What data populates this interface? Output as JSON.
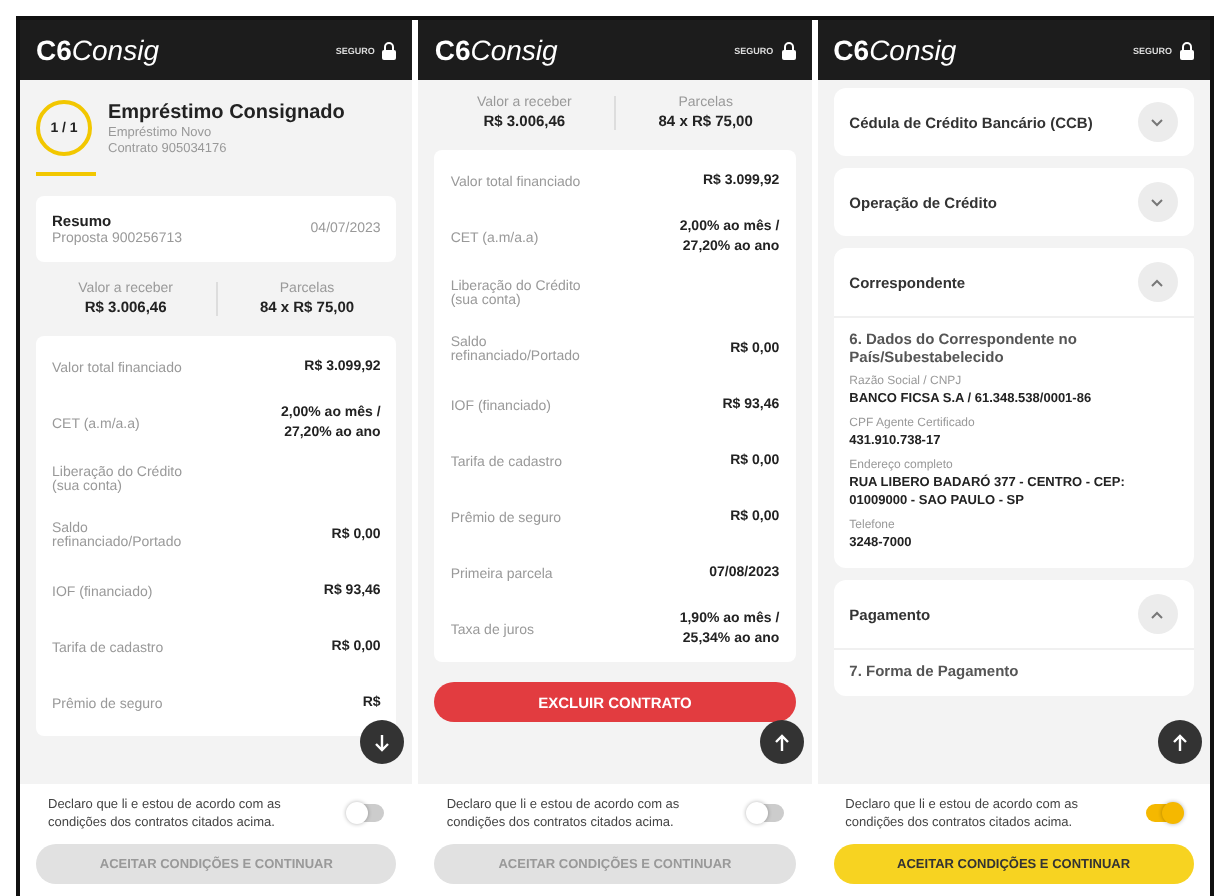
{
  "screens": [
    {
      "header": {
        "logo_mark": "C6",
        "logo_text": "Consig",
        "secure_label": "SEGURO"
      },
      "fab": {
        "kind": "scroll_down"
      },
      "blocks": [
        {
          "kind": "contract",
          "counter": "1 / 1",
          "title": "Empréstimo Consignado",
          "subtitle": "Empréstimo Novo",
          "contract": "Contrato 905034176"
        },
        {
          "kind": "summary",
          "title": "Resumo",
          "proposal": "Proposta 900256713",
          "date": "04/07/2023"
        },
        {
          "kind": "amounts",
          "items": [
            {
              "label": "Valor a receber",
              "value": "R$ 3.006,46"
            },
            {
              "label": "Parcelas",
              "value": "84 x  R$ 75,00"
            }
          ]
        },
        {
          "kind": "rows",
          "rows": [
            {
              "label": "Valor total financiado",
              "value": "R$ 3.099,92"
            },
            {
              "label": "CET (a.m/a.a)",
              "value": "2,00% ao mês /\n27,20% ao ano"
            },
            {
              "label": "Liberação do Crédito\n(sua conta)"
            },
            {
              "label": "Saldo\nrefinanciado/Portado",
              "value": "R$ 0,00"
            },
            {
              "label": "IOF (financiado)",
              "value": "R$ 93,46"
            },
            {
              "label": "Tarifa de cadastro",
              "value": "R$ 0,00"
            },
            {
              "label": "Prêmio de seguro",
              "value": "R$"
            }
          ]
        }
      ],
      "footer": {
        "consent": "Declaro que li e estou de acordo com as condições dos contratos citados acima.",
        "agreed": false,
        "button": "ACEITAR CONDIÇÕES E CONTINUAR",
        "enabled": false
      }
    },
    {
      "header": {
        "logo_mark": "C6",
        "logo_text": "Consig",
        "secure_label": "SEGURO"
      },
      "fab": {
        "kind": "scroll_up"
      },
      "blocks": [
        {
          "kind": "amounts",
          "items": [
            {
              "label": "Valor a receber",
              "value": "R$ 3.006,46"
            },
            {
              "label": "Parcelas",
              "value": "84 x  R$ 75,00"
            }
          ]
        },
        {
          "kind": "rows",
          "rows": [
            {
              "label": "Valor total financiado",
              "value": "R$ 3.099,92"
            },
            {
              "label": "CET (a.m/a.a)",
              "value": "2,00% ao mês /\n27,20% ao ano"
            },
            {
              "label": "Liberação do Crédito\n(sua conta)"
            },
            {
              "label": "Saldo\nrefinanciado/Portado",
              "value": "R$ 0,00"
            },
            {
              "label": "IOF (financiado)",
              "value": "R$ 93,46"
            },
            {
              "label": "Tarifa de cadastro",
              "value": "R$ 0,00"
            },
            {
              "label": "Prêmio de seguro",
              "value": "R$ 0,00"
            },
            {
              "label": "Primeira parcela",
              "value": "07/08/2023"
            },
            {
              "label": "Taxa de juros",
              "value": "1,90% ao mês /\n25,34% ao ano"
            }
          ]
        },
        {
          "kind": "danger_button",
          "label": "EXCLUIR CONTRATO"
        }
      ],
      "footer": {
        "consent": "Declaro que li e estou de acordo com as condições dos contratos citados acima.",
        "agreed": false,
        "button": "ACEITAR CONDIÇÕES E CONTINUAR",
        "enabled": false
      }
    },
    {
      "header": {
        "logo_mark": "C6",
        "logo_text": "Consig",
        "secure_label": "SEGURO"
      },
      "fab": {
        "kind": "scroll_up"
      },
      "blocks": [
        {
          "kind": "accordion",
          "title": "Cédula de Crédito Bancário (CCB)",
          "expanded": false
        },
        {
          "kind": "accordion",
          "title": "Operação de Crédito",
          "expanded": false
        },
        {
          "kind": "accordion",
          "title": "Correspondente",
          "expanded": true,
          "heading": "6. Dados do Correspondente no País/Subestabelecido",
          "fields": [
            {
              "label": "Razão Social / CNPJ",
              "value": "BANCO FICSA S.A / 61.348.538/0001-86"
            },
            {
              "label": "CPF Agente Certificado",
              "value": "431.910.738-17"
            },
            {
              "label": "Endereço completo",
              "value": "RUA LIBERO BADARÓ 377 - CENTRO - CEP: 01009000 - SAO PAULO - SP"
            },
            {
              "label": "Telefone",
              "value": "3248-7000"
            }
          ]
        },
        {
          "kind": "accordion",
          "title": "Pagamento",
          "expanded": true,
          "heading": "7. Forma de Pagamento"
        }
      ],
      "footer": {
        "consent": "Declaro que li e estou de acordo com as condições dos contratos citados acima.",
        "agreed": true,
        "button": "ACEITAR CONDIÇÕES E CONTINUAR",
        "enabled": true
      }
    }
  ]
}
